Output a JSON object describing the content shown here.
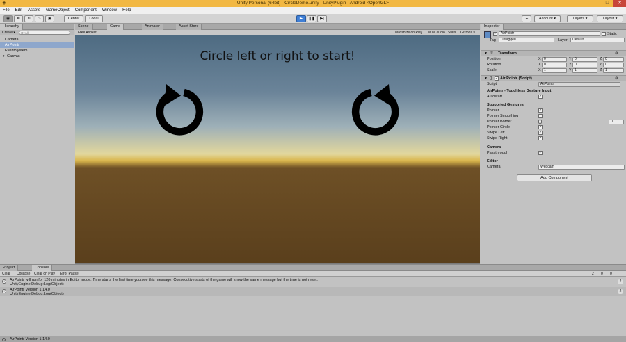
{
  "window": {
    "title": "Unity Personal (64bit) - CircleDemo.unity - UnityPlugin - Android <OpenGL>",
    "min_icon": "–",
    "max_icon": "□",
    "close_icon": "✕"
  },
  "menu": [
    "File",
    "Edit",
    "Assets",
    "GameObject",
    "Component",
    "Window",
    "Help"
  ],
  "toolbar": {
    "pivot": "Center",
    "space": "Local",
    "account": "Account ▾",
    "layers": "Layers ▾",
    "layout": "Layout ▾",
    "play_icon": "▶",
    "pause_icon": "❚❚",
    "step_icon": "▶|"
  },
  "hierarchy": {
    "tab": "Hierarchy",
    "create": "Create ▾",
    "search_placeholder": "Q▾All",
    "items": [
      "Camera",
      "AirPointr",
      "EventSystem",
      "► Canvas"
    ]
  },
  "game": {
    "tabs": [
      "Scene",
      "Game",
      "Animator",
      "Asset Store"
    ],
    "aspect": "Free Aspect",
    "options": [
      "Maximize on Play",
      "Mute audio",
      "Stats",
      "Gizmos ▾"
    ],
    "message": "Circle left or right to start!"
  },
  "inspector": {
    "tab": "Inspector",
    "object_name": "AirPointr",
    "static_label": "Static",
    "tag_label": "Tag",
    "tag_value": "Untagged",
    "layer_label": "Layer",
    "layer_value": "Default",
    "transform": {
      "title": "Transform",
      "rows": [
        {
          "label": "Position",
          "x": "0",
          "y": "0",
          "z": "0"
        },
        {
          "label": "Rotation",
          "x": "0",
          "y": "0",
          "z": "0"
        },
        {
          "label": "Scale",
          "x": "1",
          "y": "1",
          "z": "1"
        }
      ]
    },
    "script_component": {
      "title": "Air Pointr (Script)",
      "script_label": "Script",
      "script_value": "AirPointr"
    },
    "plugin_header": "AirPointr - Touchless Gesture Input",
    "autostart": "Autostart",
    "gestures_header": "Supported Gestures",
    "gestures": [
      {
        "label": "Pointer",
        "checked": true
      },
      {
        "label": "Pointer Smoothing",
        "checked": false
      },
      {
        "label": "Pointer Border",
        "checked": null
      },
      {
        "label": "Pointer Circle",
        "checked": true
      },
      {
        "label": "Swipe Left",
        "checked": true
      },
      {
        "label": "Swipe Right",
        "checked": true
      }
    ],
    "pointer_border_value": "0",
    "camera_header": "Camera",
    "passthrough": "Passthrough",
    "editor_header": "Editor",
    "camera_label": "Camera",
    "camera_value": "Webcam",
    "add_component": "Add Component"
  },
  "console": {
    "tabs": [
      "Project",
      "Console"
    ],
    "buttons": [
      "Clear",
      "Collapse",
      "Clear on Play",
      "Error Pause"
    ],
    "counts": [
      "2",
      "0",
      "0"
    ],
    "entries": [
      {
        "line1": "AirPointr will run for 120 minutes in Editor mode. Time starts the first time you see this message. Consecutive starts of the game will show the same message but the time is not reset.",
        "line2": "UnityEngine.Debug:Log(Object)",
        "count": "2"
      },
      {
        "line1": "AirPointr Version 1.14.0",
        "line2": "UnityEngine.Debug:Log(Object)",
        "count": "2"
      }
    ]
  },
  "status": "AirPointr Version 1.14.0"
}
